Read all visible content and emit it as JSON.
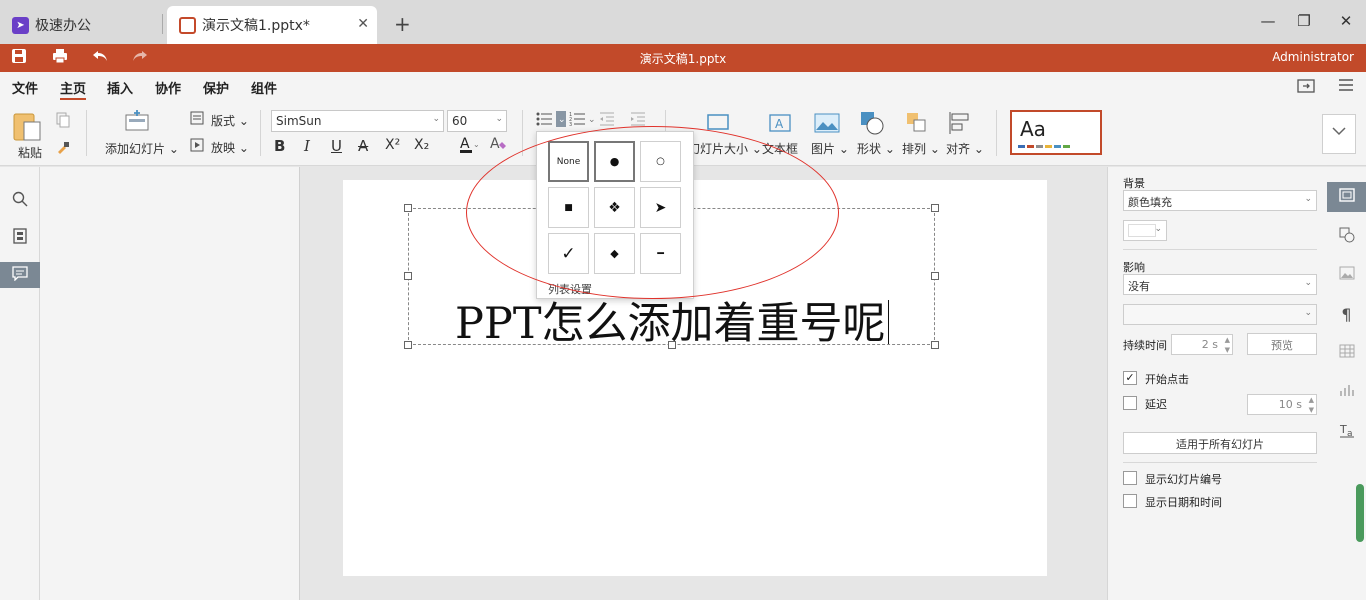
{
  "tabs": {
    "home_label": "极速办公",
    "doc_label": "演示文稿1.pptx*",
    "close_glyph": "✕",
    "add_glyph": "+"
  },
  "window": {
    "minimize": "—",
    "maximize": "❐",
    "close": "✕"
  },
  "header": {
    "title": "演示文稿1.pptx",
    "user": "Administrator",
    "accent_color": "#c24a2a"
  },
  "menu": {
    "items": [
      "文件",
      "主页",
      "插入",
      "协作",
      "保护",
      "组件"
    ],
    "active": "主页"
  },
  "ribbon": {
    "paste": "粘贴",
    "add_slide": "添加幻灯片",
    "layout": "版式",
    "play": "放映",
    "font_name": "SimSun",
    "font_size": "60",
    "bold": "B",
    "italic": "I",
    "underline": "U",
    "strike": "A",
    "superscript": "X²",
    "subscript": "X₂",
    "slide_size": "幻灯片大小",
    "textbox": "文本框",
    "picture": "图片",
    "shape": "形状",
    "arrange": "排列",
    "align": "对齐",
    "theme_sample": "Aa",
    "theme_colors": [
      "#3b6db4",
      "#c24a2a",
      "#8e8e8e",
      "#e8b43a",
      "#4a90c2",
      "#62a845"
    ]
  },
  "slide": {
    "text": "PPT怎么添加着重号呢"
  },
  "bullet_popup": {
    "none_label": "None",
    "symbols": [
      "●",
      "○",
      "■",
      "❖",
      "➤",
      "✓",
      "◆",
      "━"
    ],
    "footer": "列表设置"
  },
  "right_panel": {
    "background_label": "背景",
    "background_value": "颜色填充",
    "effect_label": "影响",
    "effect_value": "没有",
    "duration_label": "持续时间",
    "duration_value": "2 s",
    "preview": "预览",
    "start_on_click": "开始点击",
    "start_on_click_checked": true,
    "delay": "延迟",
    "delay_checked": false,
    "delay_value": "10 s",
    "apply_all": "适用于所有幻灯片",
    "show_slide_number": "显示幻灯片编号",
    "show_datetime": "显示日期和时间"
  }
}
